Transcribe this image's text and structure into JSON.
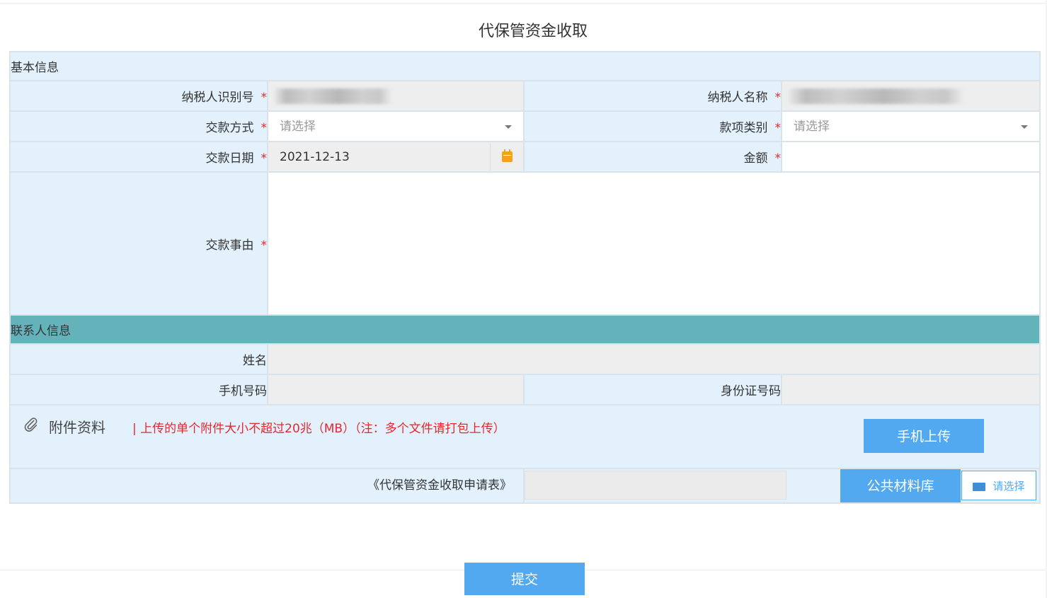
{
  "page": {
    "title": "代保管资金收取"
  },
  "sections": {
    "basic": "基本信息",
    "contact": "联系人信息"
  },
  "fields": {
    "taxpayer_id_label": "纳税人识别号",
    "taxpayer_name_label": "纳税人名称",
    "payment_method_label": "交款方式",
    "payment_method_placeholder": "请选择",
    "fund_type_label": "款项类别",
    "fund_type_placeholder": "请选择",
    "payment_date_label": "交款日期",
    "payment_date_value": "2021-12-13",
    "amount_label": "金额",
    "reason_label": "交款事由",
    "required_mark": "*"
  },
  "contact": {
    "name_label": "姓名",
    "phone_label": "手机号码",
    "id_label": "身份证号码"
  },
  "attachments": {
    "title": "附件资料",
    "note": "| 上传的单个附件大小不超过20兆（MB）（注：多个文件请打包上传）",
    "mobile_upload": "手机上传",
    "file_label": "《代保管资金收取申请表》",
    "public_library": "公共材料库",
    "choose": "请选择"
  },
  "actions": {
    "submit": "提交"
  },
  "icons": {
    "calendar": "calendar-icon",
    "paperclip": "paperclip-icon",
    "folder": "folder-open-icon",
    "dropdown": "chevron-down-icon"
  },
  "colors": {
    "label_bg": "#e3f1fd",
    "section_teal": "#64b3bb",
    "primary": "#53a9f0",
    "required": "#e8262d",
    "calendar": "#f3a31b"
  }
}
